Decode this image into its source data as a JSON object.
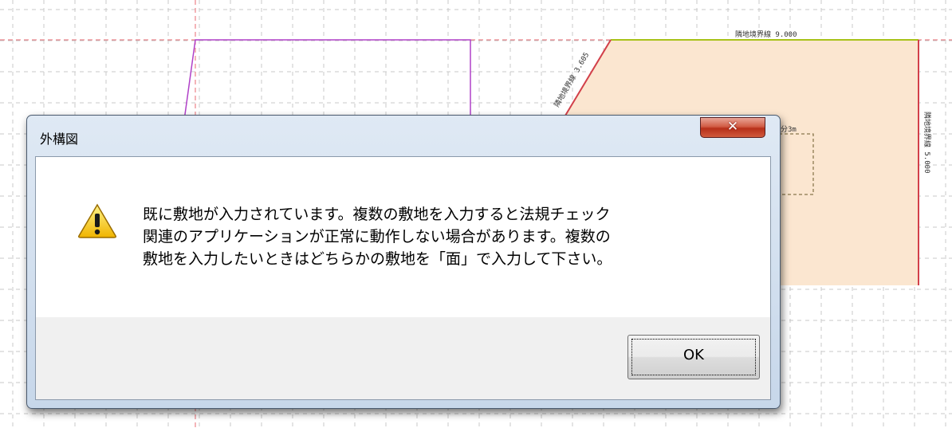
{
  "background": {
    "labels": [
      "隣地境界線 9.000",
      "隣地境界線 3.605",
      "隣地境界線 5.000",
      "分3m"
    ]
  },
  "dialog": {
    "title": "外構図",
    "close_glyph": "✕",
    "icon": "warning-icon",
    "message": "既に敷地が入力されています。複数の敷地を入力すると法規チェック\n関連のアプリケーションが正常に動作しない場合があります。複数の\n敷地を入力したいときはどちらかの敷地を「面」で入力して下さい。",
    "ok_label": "OK"
  },
  "colors": {
    "site_fill": "#fbe6d0",
    "boundary_red": "#d2404a",
    "boundary_green": "#a8c21a",
    "outline_purple": "#b040c8",
    "close_red": "#c44a33"
  }
}
